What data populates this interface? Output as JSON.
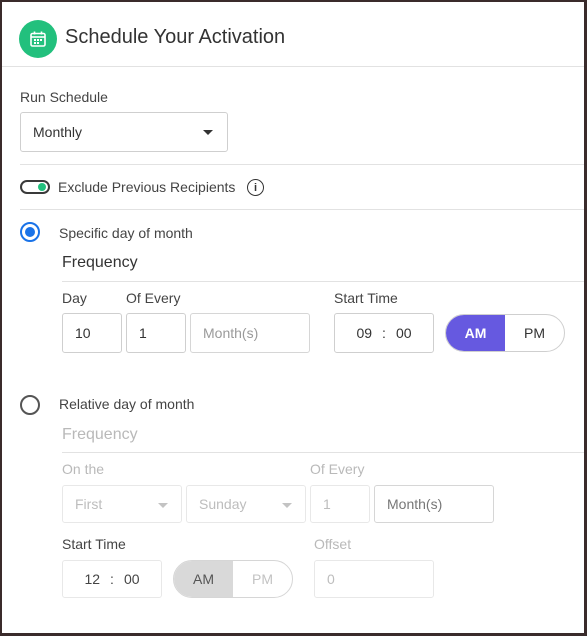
{
  "header": {
    "title": "Schedule Your Activation",
    "icon": "calendar-icon",
    "icon_color": "#22c07d"
  },
  "run_schedule": {
    "label": "Run Schedule",
    "value": "Monthly"
  },
  "exclude": {
    "label": "Exclude Previous Recipients",
    "checked": true
  },
  "specific": {
    "label": "Specific day of month",
    "selected": true,
    "frequency_title": "Frequency",
    "day_label": "Day",
    "day_value": "10",
    "of_every_label": "Of Every",
    "of_every_value": "1",
    "unit": "Month(s)",
    "start_time_label": "Start Time",
    "hour": "09",
    "sep": ":",
    "minute": "00",
    "am": "AM",
    "pm": "PM",
    "accent": "#6659e0"
  },
  "relative": {
    "label": "Relative day of month",
    "selected": false,
    "frequency_title": "Frequency",
    "on_the_label": "On the",
    "ordinal": "First",
    "weekday": "Sunday",
    "of_every_label": "Of Every",
    "of_every_value": "1",
    "unit": "Month(s)",
    "start_time_label": "Start Time",
    "hour": "12",
    "sep": ":",
    "minute": "00",
    "am": "AM",
    "pm": "PM",
    "offset_label": "Offset",
    "offset_value": "0"
  }
}
